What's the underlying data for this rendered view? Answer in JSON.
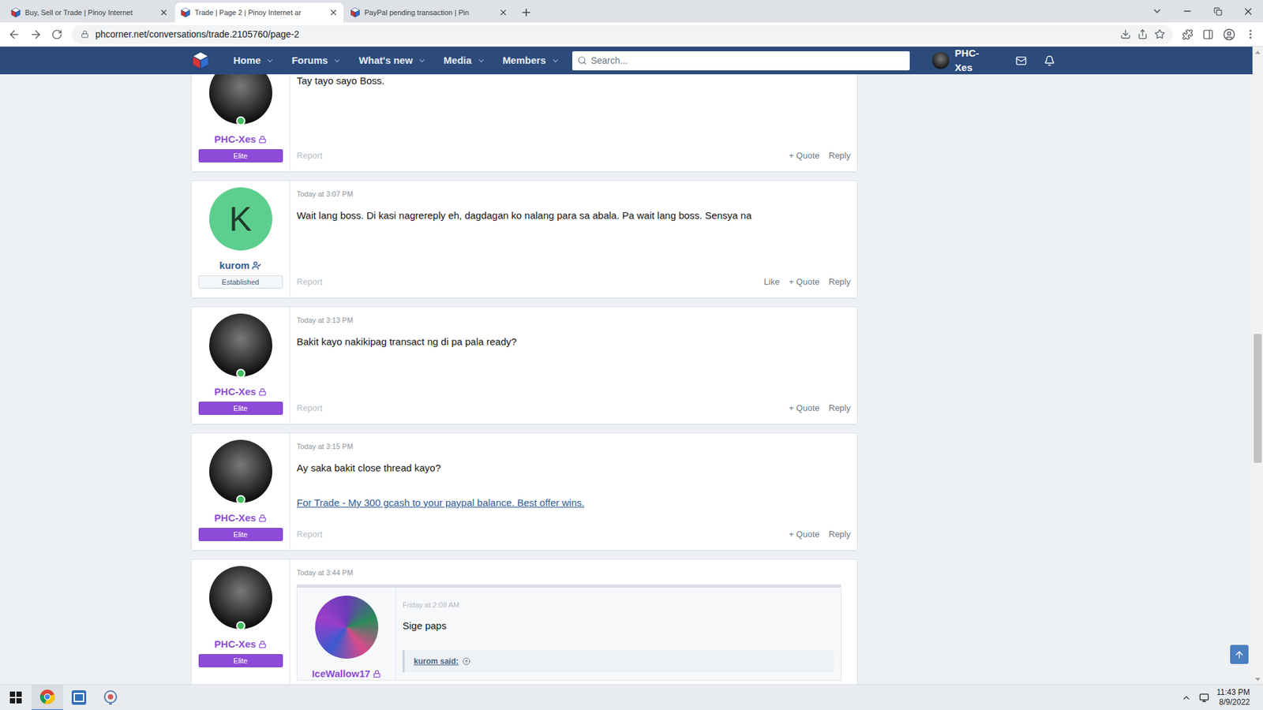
{
  "browser": {
    "tabs": [
      {
        "label": "Buy, Sell or Trade | Pinoy Internet",
        "selected": false
      },
      {
        "label": "Trade | Page 2 | Pinoy Internet ar",
        "selected": true
      },
      {
        "label": "PayPal pending transaction | Pin",
        "selected": false
      }
    ],
    "url": "phcorner.net/conversations/trade.2105760/page-2"
  },
  "nav": {
    "items": [
      "Home",
      "Forums",
      "What's new",
      "Media",
      "Members"
    ],
    "search_placeholder": "Search...",
    "user": "PHC-Xes"
  },
  "posts": [
    {
      "author": "PHC-Xes",
      "name_icon": "lock",
      "rank": "Elite",
      "rank_kind": "elite",
      "online": true,
      "avatar_letter": "",
      "time": "",
      "message": "Tay tayo sayo Boss.",
      "link": "",
      "report": "Report",
      "actions": [
        "+ Quote",
        "Reply"
      ],
      "quote": null
    },
    {
      "author": "kurom",
      "name_icon": "verified",
      "rank": "Established",
      "rank_kind": "established",
      "online": false,
      "avatar_letter": "K",
      "time": "Today at 3:07 PM",
      "message": "Wait lang boss. Di kasi nagrereply eh, dagdagan ko nalang para sa abala. Pa wait lang boss. Sensya na",
      "link": "",
      "report": "Report",
      "actions": [
        "Like",
        "+ Quote",
        "Reply"
      ],
      "quote": null
    },
    {
      "author": "PHC-Xes",
      "name_icon": "lock",
      "rank": "Elite",
      "rank_kind": "elite",
      "online": true,
      "avatar_letter": "",
      "time": "Today at 3:13 PM",
      "message": "Bakit kayo nakikipag transact ng di pa pala ready?",
      "link": "",
      "report": "Report",
      "actions": [
        "+ Quote",
        "Reply"
      ],
      "quote": null
    },
    {
      "author": "PHC-Xes",
      "name_icon": "lock",
      "rank": "Elite",
      "rank_kind": "elite",
      "online": true,
      "avatar_letter": "",
      "time": "Today at 3:15 PM",
      "message": "Ay saka bakit close thread kayo?",
      "link": "For Trade - My 300 gcash to your paypal balance. Best offer wins.",
      "report": "Report",
      "actions": [
        "+ Quote",
        "Reply"
      ],
      "quote": null
    },
    {
      "author": "PHC-Xes",
      "name_icon": "lock",
      "rank": "Elite",
      "rank_kind": "elite",
      "online": true,
      "avatar_letter": "",
      "time": "Today at 3:44 PM",
      "message": "",
      "link": "",
      "report": "",
      "actions": [],
      "quote": {
        "author": "IceWallow17",
        "name_icon": "lock",
        "time": "Friday at 2:08 AM",
        "message": "Sige paps",
        "nested_author": "kurom said:"
      }
    }
  ],
  "taskbar": {
    "apps": [
      {
        "kind": "chrome",
        "active": true
      },
      {
        "kind": "mail",
        "active": false
      },
      {
        "kind": "tool",
        "active": false
      }
    ],
    "time": "11:43 PM",
    "date": "8/9/2022"
  }
}
